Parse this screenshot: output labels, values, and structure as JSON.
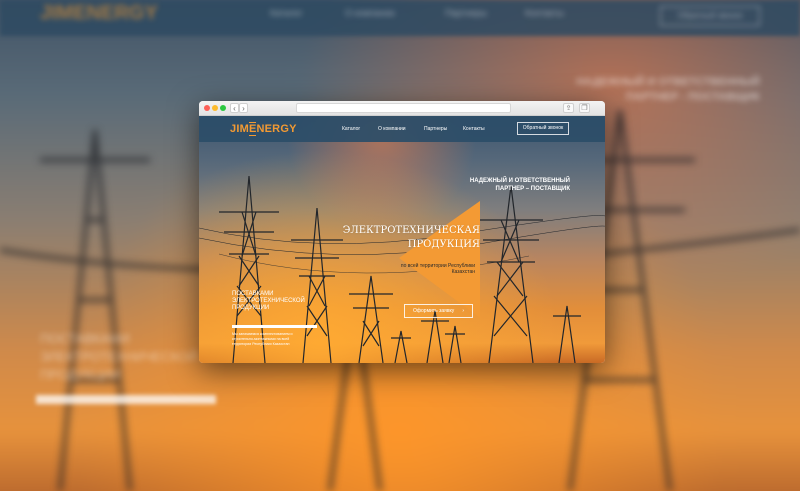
{
  "background": {
    "blurred_logo": "JIMENERGY",
    "blurred_menu": [
      "Каталог",
      "О компании",
      "Партнеры",
      "Контакты"
    ],
    "blurred_button": "Обратный звонок",
    "blurred_tagline": "НАДЕЖНЫЙ И ОТВЕТСТВЕННЫЙ ПАРТНЕР - ПОСТАВЩИК",
    "blurred_left_text": "ПОСТАВКАМИ ЭЛЕКТРОТЕХНИЧЕСКОЙ ПРОДУКЦИИ"
  },
  "browser": {
    "back_icon": "chevron-left-icon",
    "forward_icon": "chevron-right-icon",
    "share_icon": "share-icon",
    "tabs_icon": "tabs-icon"
  },
  "site": {
    "logo": {
      "part1": "JIM",
      "part2": "ERGY",
      "mark": "E"
    },
    "nav": [
      "Каталог",
      "О компании",
      "Партнеры",
      "Контакты"
    ],
    "callback_label": "Обратный звонок",
    "tagline_line1": "НАДЕЖНЫЙ И ОТВЕТСТВЕННЫЙ",
    "tagline_line2": "ПАРТНЕР – ПОСТАВЩИК",
    "hero_title_line1": "ЭЛЕКТРОТЕХНИЧЕСКАЯ",
    "hero_title_line2": "ПРОДУКЦИЯ",
    "hero_sub_line1": "по всей территории Республики",
    "hero_sub_line2": "Казахстан",
    "order_label": "Оформить заявку",
    "order_arrow": "›",
    "left_heading_line1": "ПОСТАВКАМИ",
    "left_heading_line2": "ЭЛЕКТРОТЕХНИЧЕСКОЙ",
    "left_heading_line3": "ПРОДУКЦИИ",
    "left_small_line1": "Мы занимаемся комплектованием и",
    "left_small_line2": "строительно-монтажными на всей",
    "left_small_line3": "территории Республики Казахстан"
  },
  "colors": {
    "accent_orange": "#f29a33",
    "header_blue": "#2c4e68"
  }
}
